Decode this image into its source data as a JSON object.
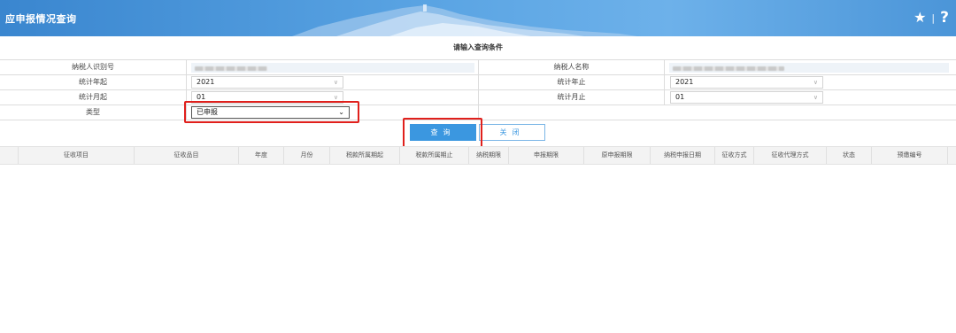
{
  "header": {
    "title": "应申报情况查询",
    "star_icon": "★",
    "separator": "|",
    "help_icon": "?"
  },
  "form": {
    "title": "请输入查询条件",
    "rows": [
      {
        "left_label": "纳税人识别号",
        "right_label": "纳税人名称"
      },
      {
        "left_label": "统计年起",
        "left_value": "2021",
        "right_label": "统计年止",
        "right_value": "2021"
      },
      {
        "left_label": "统计月起",
        "left_value": "01",
        "right_label": "统计月止",
        "right_value": "01"
      },
      {
        "left_label": "类型",
        "left_value": "已申报"
      }
    ]
  },
  "buttons": {
    "query": "查询",
    "close": "关闭"
  },
  "table": {
    "columns": [
      "征收项目",
      "征收品目",
      "年度",
      "月份",
      "税款所属期起",
      "税款所属期止",
      "纳税期限",
      "申报期限",
      "原申报期限",
      "纳税申报日期",
      "征收方式",
      "征收代理方式",
      "状态",
      "预缴编号"
    ]
  },
  "colors": {
    "header_bg": "#4b95d8",
    "primary_button": "#3b97e0",
    "highlight_border": "#e0201c"
  }
}
